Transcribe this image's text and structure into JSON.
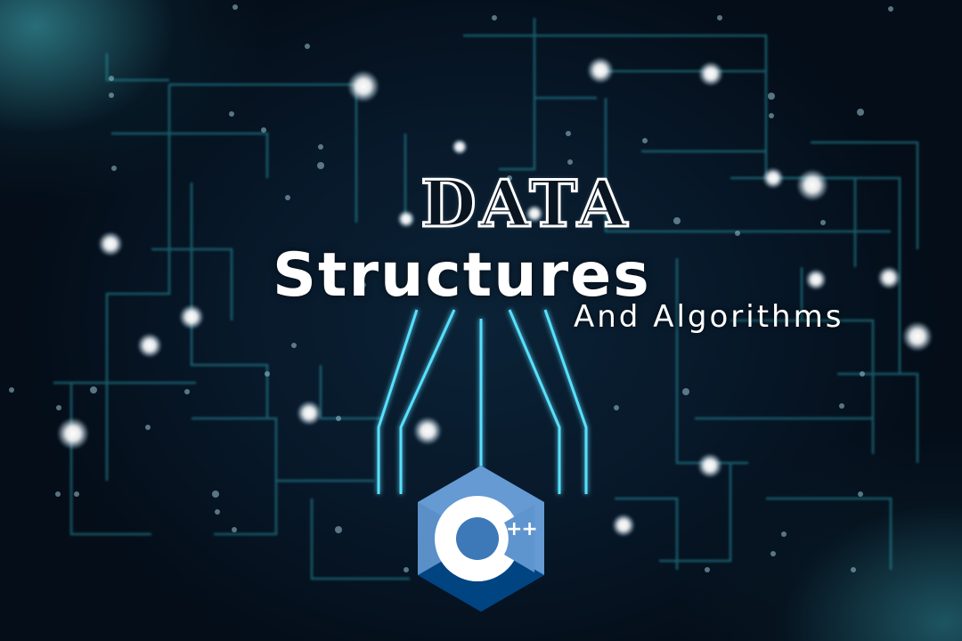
{
  "title": {
    "line1": "DATA",
    "line2": "Structures",
    "line3": "And Algorithms"
  },
  "logo": {
    "icon": "cpp-logo-icon",
    "letter": "C",
    "suffix": "++",
    "colors": {
      "light": "#659ad2",
      "mid": "#00599c",
      "dark": "#004482"
    }
  },
  "theme": {
    "background": "#071829",
    "circuit_line": "#2aa3b2",
    "glow_line": "#5fe3ff",
    "node": "#ffffff"
  }
}
